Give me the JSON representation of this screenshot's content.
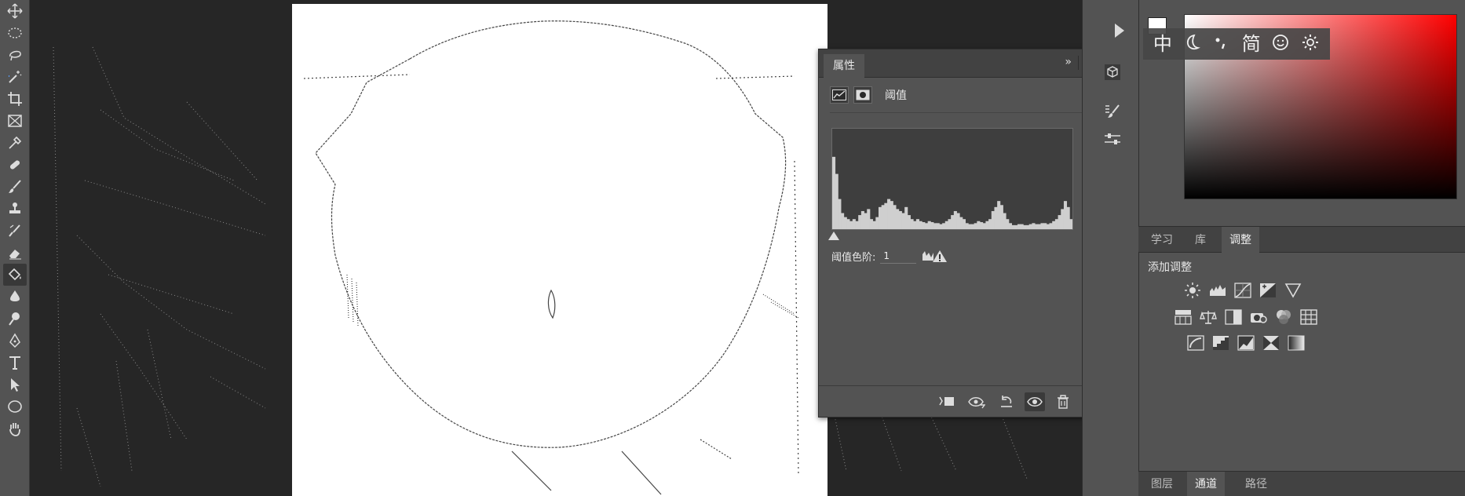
{
  "toolbar": {
    "tools": [
      {
        "name": "move-tool",
        "icon": "move-icon"
      },
      {
        "name": "marquee-tool",
        "icon": "ellipse-marquee-icon"
      },
      {
        "name": "lasso-tool",
        "icon": "lasso-icon"
      },
      {
        "name": "magic-wand-tool",
        "icon": "magic-wand-icon"
      },
      {
        "name": "crop-tool",
        "icon": "crop-icon"
      },
      {
        "name": "frame-tool",
        "icon": "frame-icon"
      },
      {
        "name": "eyedropper-tool",
        "icon": "eyedropper-icon"
      },
      {
        "name": "healing-brush-tool",
        "icon": "bandage-icon"
      },
      {
        "name": "brush-tool",
        "icon": "brush-icon"
      },
      {
        "name": "clone-stamp-tool",
        "icon": "stamp-icon"
      },
      {
        "name": "history-brush-tool",
        "icon": "history-brush-icon"
      },
      {
        "name": "eraser-tool",
        "icon": "eraser-icon"
      },
      {
        "name": "paint-bucket-tool",
        "icon": "paint-bucket-icon"
      },
      {
        "name": "blur-tool",
        "icon": "blur-icon"
      },
      {
        "name": "dodge-tool",
        "icon": "dodge-icon"
      },
      {
        "name": "pen-tool",
        "icon": "pen-icon"
      },
      {
        "name": "type-tool",
        "icon": "type-icon"
      },
      {
        "name": "path-selection-tool",
        "icon": "arrow-icon"
      },
      {
        "name": "ellipse-tool",
        "icon": "ellipse-icon"
      },
      {
        "name": "hand-tool",
        "icon": "hand-icon"
      }
    ],
    "active_tool": "paint-bucket-tool"
  },
  "properties_panel": {
    "tab_label": "属性",
    "collapse_label": "»",
    "menu_label": "≡",
    "adjustment_type": "阈值",
    "histogram_heights": [
      0.72,
      0.55,
      0.3,
      0.16,
      0.12,
      0.1,
      0.08,
      0.1,
      0.08,
      0.14,
      0.18,
      0.16,
      0.2,
      0.1,
      0.08,
      0.12,
      0.22,
      0.24,
      0.26,
      0.3,
      0.28,
      0.24,
      0.2,
      0.18,
      0.16,
      0.22,
      0.14,
      0.1,
      0.08,
      0.1,
      0.08,
      0.07,
      0.06,
      0.08,
      0.07,
      0.06,
      0.06,
      0.05,
      0.06,
      0.08,
      0.1,
      0.14,
      0.18,
      0.16,
      0.12,
      0.1,
      0.06,
      0.05,
      0.05,
      0.06,
      0.08,
      0.07,
      0.06,
      0.08,
      0.1,
      0.18,
      0.22,
      0.28,
      0.24,
      0.16,
      0.1,
      0.06,
      0.04,
      0.04,
      0.05,
      0.05,
      0.04,
      0.04,
      0.05,
      0.06,
      0.05,
      0.05,
      0.06,
      0.06,
      0.05,
      0.06,
      0.08,
      0.1,
      0.14,
      0.2,
      0.28,
      0.22,
      0.1
    ],
    "threshold_label": "阈值色阶:",
    "threshold_value": "1",
    "footer_buttons": [
      "clip-to-layer-icon",
      "view-previous-icon",
      "reset-icon",
      "visibility-eye-icon",
      "trash-icon"
    ]
  },
  "ime_bar": {
    "items": [
      "中",
      "moon-icon",
      "punctuation-icon",
      "简",
      "smiley-icon",
      "gear-icon"
    ],
    "lang": "中",
    "script": "简"
  },
  "right_panel": {
    "tabs": [
      {
        "label": "学习",
        "active": false
      },
      {
        "label": "库",
        "active": false
      },
      {
        "label": "调整",
        "active": true
      }
    ],
    "adjust_title": "添加调整",
    "adjustment_rows": [
      [
        "brightness-contrast-icon",
        "levels-icon",
        "curves-icon",
        "exposure-icon",
        "vibrance-icon"
      ],
      [
        "hue-saturation-icon",
        "color-balance-icon",
        "black-white-icon",
        "photo-filter-icon",
        "channel-mixer-icon",
        "color-lookup-icon"
      ],
      [
        "invert-icon",
        "posterize-icon",
        "threshold-icon",
        "selective-color-icon",
        "gradient-map-icon"
      ]
    ],
    "bottom_tabs": [
      {
        "label": "图层",
        "active": false
      },
      {
        "label": "通道",
        "active": true
      },
      {
        "label": "路径",
        "active": false
      }
    ]
  },
  "colors": {
    "panel_bg": "#535353",
    "canvas_bg": "#262626",
    "picker_hue": "#ff0000"
  }
}
